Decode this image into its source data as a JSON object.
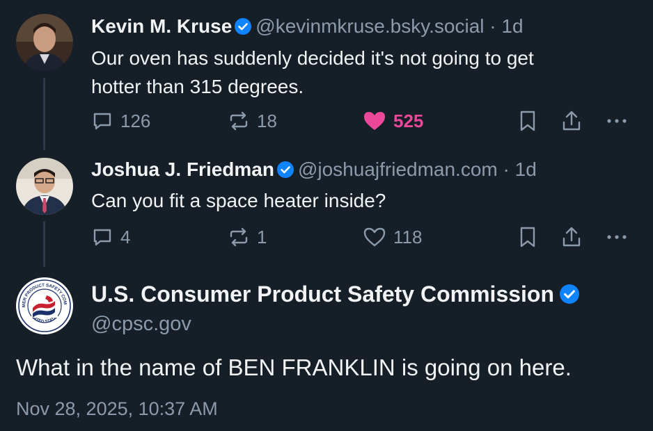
{
  "posts": [
    {
      "name": "Kevin M. Kruse",
      "handle": "@kevinmkruse.bsky.social",
      "separator": "·",
      "age": "1d",
      "text_lines": [
        "Our oven has suddenly decided it's not going to get",
        "hotter than 315 degrees."
      ],
      "replies": "126",
      "reposts": "18",
      "likes": "525",
      "liked": true
    },
    {
      "name": "Joshua J. Friedman",
      "handle": "@joshuajfriedman.com",
      "separator": "·",
      "age": "1d",
      "text_lines": [
        "Can you fit a space heater inside?"
      ],
      "replies": "4",
      "reposts": "1",
      "likes": "118",
      "liked": false
    }
  ],
  "main_post": {
    "name": "U.S. Consumer Product Safety Commission",
    "handle": "@cpsc.gov",
    "text": "What in the name of BEN FRANKLIN is going on here.",
    "timestamp": "Nov 28, 2025, 10:37 AM",
    "seal_text_top": "CONSUMER PRODUCT SAFETY COMMISSION",
    "seal_text_bottom": "UNITED STATES"
  },
  "colors": {
    "background": "#161e27",
    "muted": "#8c9bab",
    "verified": "#1083fe",
    "like": "#ec4899"
  },
  "icons": [
    "verified-badge-icon",
    "reply-icon",
    "repost-icon",
    "heart-icon",
    "bookmark-icon",
    "share-icon",
    "more-icon"
  ]
}
